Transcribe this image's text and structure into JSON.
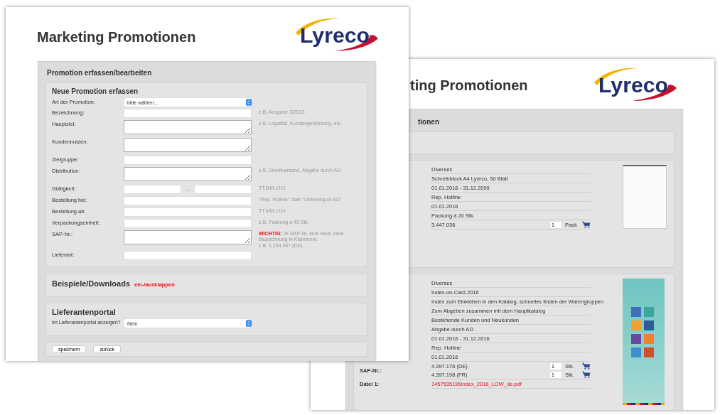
{
  "front_window": {
    "title": "Marketing Promotionen",
    "logo": "Lyreco",
    "panel_title": "Promotion erfassen/bearbeiten",
    "form": {
      "title": "Neue Promotion erfassen",
      "rows": [
        {
          "kind": "select",
          "label": "Art der Promotion:",
          "value": "bitte wählen..."
        },
        {
          "kind": "input",
          "label": "Bezeichnung:",
          "hint": "z.B. Ausgabe 3/2013"
        },
        {
          "kind": "textarea",
          "label": "Hauptziel:",
          "hint": "z.B. Loyalität, Kundengewinnung, etc."
        },
        {
          "kind": "textarea",
          "label": "Kundennutzen:"
        },
        {
          "kind": "input",
          "label": "Zielgruppe:"
        },
        {
          "kind": "textarea",
          "label": "Distribution:",
          "hint": "z.B. Direktversand, Abgabe durch AD"
        },
        {
          "kind": "daterange",
          "label": "Gültigkeit:",
          "separator": "-",
          "hint": "TT.MM.JJJJ"
        },
        {
          "kind": "input",
          "label": "Bestellung bei:",
          "hint": "\"Rep. Hotline\" oder \"Lieferung an AD\""
        },
        {
          "kind": "input",
          "label": "Bestellung ab:",
          "hint": "TT.MM.JJJJ"
        },
        {
          "kind": "input",
          "label": "Verpackungseinheit:",
          "hint": "z.B. Packung à 40 Stk."
        },
        {
          "kind": "textarea",
          "label": "SAP-Nr.:",
          "hint": "**WICHTIG:** Je SAP-Nr. eine neue Zeile. Bezeichnung in Klammern.",
          "hint_2": "z.B. 1.234.567 (DE)"
        },
        {
          "kind": "input",
          "label": "Lieferant:"
        }
      ]
    },
    "downloads": {
      "title": "Beispiele/Downloads",
      "link": "ein-/ausklappen"
    },
    "portal": {
      "title": "Lieferantenportal",
      "label": "Im Lieferantenportal anzeigen?",
      "value": "Nein"
    },
    "buttons": [
      "speichern",
      "zurück"
    ]
  },
  "back_window": {
    "title": "ting Promotionen",
    "logo": "Lyreco",
    "panel_title": "tionen",
    "items": [
      {
        "kind": "notepad",
        "rows": [
          {
            "value": "Diverses"
          },
          {
            "value": "Schreibblock A4 Lyreco, 50 Blatt"
          },
          {
            "value": "01.01.2016 - 31.12.2099"
          },
          {
            "value": "Rep. Hotline"
          },
          {
            "value": "01.01.2016"
          },
          {
            "value": "Packung à 20 Stk."
          },
          {
            "value": "3.447.036",
            "qty": "1",
            "unit": "Pack"
          }
        ]
      },
      {
        "kind": "poster",
        "rows": [
          {
            "value": "Diverses"
          },
          {
            "value": "Index-on-Card 2016"
          },
          {
            "value": "Index zum Einkleben in den Katalog, schnelles finden der Warengruppen"
          },
          {
            "value": "Zum Abgeben zusammen mit dem Hauptkatalog"
          },
          {
            "value": "Bestehende Kunden und Neukunden"
          },
          {
            "value": "Abgabe durch AD"
          },
          {
            "value": "01.01.2016 - 31.12.2016"
          },
          {
            "value": "Rep. Hotline"
          },
          {
            "value": "01.01.2016"
          },
          {
            "label": "SAP-Nr.:",
            "entries": [
              {
                "value": "4.397.176 (DE)",
                "qty": "1",
                "unit": "Stk."
              },
              {
                "value": "4.397.198 (FR)",
                "qty": "1",
                "unit": "Stk."
              }
            ]
          },
          {
            "label": "Datei 1:",
            "link": "1457535196index_2016_LOW_de.pdf"
          }
        ]
      }
    ]
  }
}
